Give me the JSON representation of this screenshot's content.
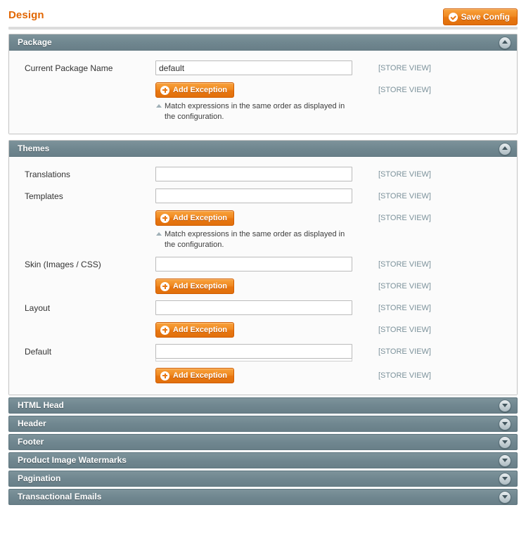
{
  "header": {
    "title": "Design",
    "save_label": "Save Config",
    "save_icon": "check-circle-icon"
  },
  "labels": {
    "scope_store_view": "[STORE VIEW]",
    "add_exception": "Add Exception",
    "add_exception_icon": "plus-circle-icon",
    "note_line1": "Match expressions in the same order as displayed in",
    "note_line2": "the configuration."
  },
  "colors": {
    "accent_orange": "#e26703",
    "section_header": "#6f868f",
    "scope_text": "#7c929b"
  },
  "sections": [
    {
      "id": "package",
      "title": "Package",
      "expanded": true,
      "toggle_icon": "collapse-up-icon",
      "rows": [
        {
          "type": "input",
          "label": "Current Package Name",
          "value": "default",
          "placeholder": "",
          "scope": "[STORE VIEW]"
        },
        {
          "type": "button-note",
          "label": "",
          "button": "Add Exception",
          "scope": "[STORE VIEW]",
          "note": true
        }
      ]
    },
    {
      "id": "themes",
      "title": "Themes",
      "expanded": true,
      "toggle_icon": "collapse-up-icon",
      "rows": [
        {
          "type": "input",
          "label": "Translations",
          "value": "",
          "placeholder": "",
          "scope": "[STORE VIEW]"
        },
        {
          "type": "input",
          "label": "Templates",
          "value": "",
          "placeholder": "",
          "scope": "[STORE VIEW]"
        },
        {
          "type": "button-note",
          "label": "",
          "button": "Add Exception",
          "scope": "[STORE VIEW]",
          "note": true
        },
        {
          "type": "input",
          "label": "Skin (Images / CSS)",
          "value": "",
          "placeholder": "",
          "scope": "[STORE VIEW]"
        },
        {
          "type": "button",
          "label": "",
          "button": "Add Exception",
          "scope": "[STORE VIEW]",
          "note": false
        },
        {
          "type": "input",
          "label": "Layout",
          "value": "",
          "placeholder": "",
          "scope": "[STORE VIEW]"
        },
        {
          "type": "button",
          "label": "",
          "button": "Add Exception",
          "scope": "[STORE VIEW]",
          "note": false
        },
        {
          "type": "input-ghost",
          "label": "Default",
          "value": "",
          "placeholder": "",
          "scope": "[STORE VIEW]"
        },
        {
          "type": "button",
          "label": "",
          "button": "Add Exception",
          "scope": "[STORE VIEW]",
          "note": false
        }
      ]
    },
    {
      "id": "html-head",
      "title": "HTML Head",
      "expanded": false,
      "toggle_icon": "expand-down-icon",
      "rows": []
    },
    {
      "id": "header",
      "title": "Header",
      "expanded": false,
      "toggle_icon": "expand-down-icon",
      "rows": []
    },
    {
      "id": "footer",
      "title": "Footer",
      "expanded": false,
      "toggle_icon": "expand-down-icon",
      "rows": []
    },
    {
      "id": "product-image-watermarks",
      "title": "Product Image Watermarks",
      "expanded": false,
      "toggle_icon": "expand-down-icon",
      "rows": []
    },
    {
      "id": "pagination",
      "title": "Pagination",
      "expanded": false,
      "toggle_icon": "expand-down-icon",
      "rows": []
    },
    {
      "id": "transactional-emails",
      "title": "Transactional Emails",
      "expanded": false,
      "toggle_icon": "expand-down-icon",
      "rows": []
    }
  ]
}
